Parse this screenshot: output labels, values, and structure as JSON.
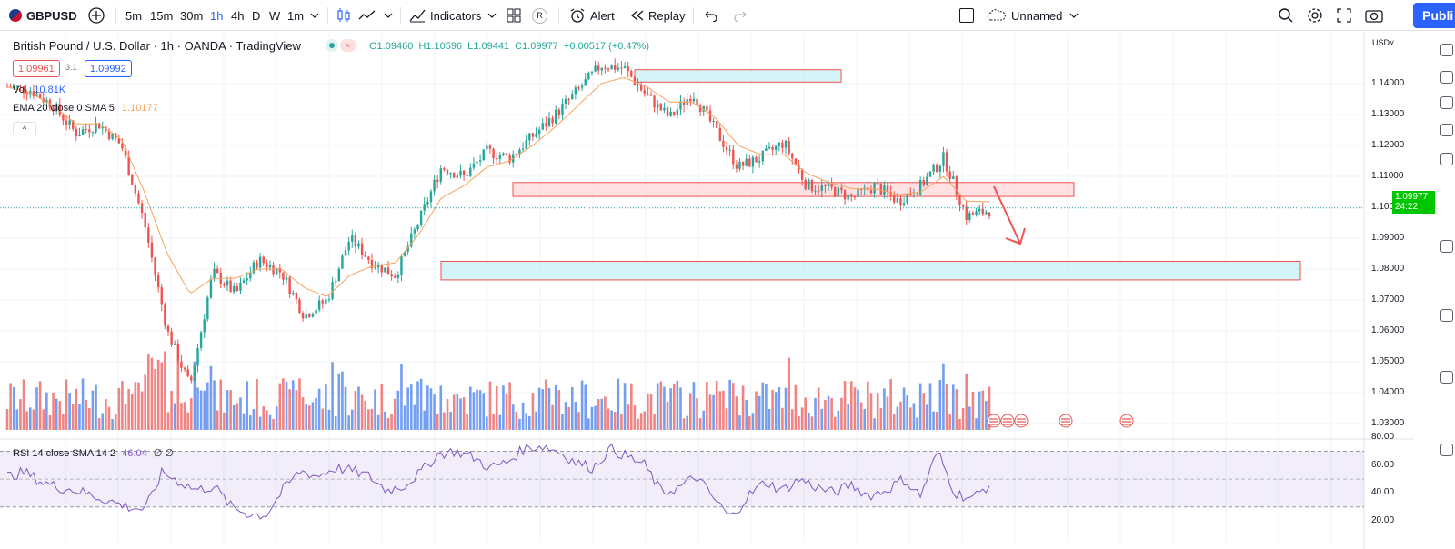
{
  "toolbar": {
    "symbol": "GBPUSD",
    "timeframes": [
      "5m",
      "15m",
      "30m",
      "1h",
      "4h",
      "D",
      "W",
      "1m"
    ],
    "active_timeframe": "1h",
    "indicators_label": "Indicators",
    "alert_label": "Alert",
    "replay_label": "Replay",
    "layout_name": "Unnamed",
    "publish_label": "Publi",
    "badge_r": "R"
  },
  "legend": {
    "title": "British Pound / U.S. Dollar · 1h · OANDA · TradingView",
    "open": "O1.09460",
    "high": "H1.10596",
    "low": "L1.09441",
    "close": "C1.09977",
    "change": "+0.00517 (+0.47%)",
    "sell_price": "1.09961",
    "spread": "3.1",
    "buy_price": "1.09992",
    "vol_label": "Vol",
    "vol_value": "10.81K",
    "ema_label": "EMA 20 close 0 SMA 5",
    "ema_value": "1.10177",
    "collapse": "^"
  },
  "rsi": {
    "label": "RSI 14 close SMA 14 2",
    "value": "46.04",
    "extra": "∅ ∅",
    "ticks": [
      "80.00",
      "60.00",
      "40.00",
      "20.00"
    ]
  },
  "price_axis": {
    "currency": "USD",
    "ticks": [
      "1.14000",
      "1.13000",
      "1.12000",
      "1.11000",
      "1.10000",
      "1.09000",
      "1.08000",
      "1.07000",
      "1.06000",
      "1.05000",
      "1.04000",
      "1.03000"
    ],
    "current_price": "1.09977",
    "countdown": "24:22"
  },
  "colors": {
    "up": "#26a69a",
    "down": "#ef5350",
    "ema": "#f7a35c",
    "rsi": "#7e57c2",
    "vol_up": "#5b8def",
    "vol_down": "#ef6f6c",
    "accent": "#2962ff",
    "current_price_bg": "#00c600"
  },
  "chart_data": {
    "type": "candlestick",
    "symbol": "GBPUSD",
    "interval": "1h",
    "ylim": [
      1.025,
      1.152
    ],
    "price_waypoints": [
      1.139,
      1.138,
      1.133,
      1.124,
      1.127,
      1.12,
      1.095,
      1.06,
      1.042,
      1.079,
      1.072,
      1.083,
      1.079,
      1.065,
      1.07,
      1.09,
      1.082,
      1.078,
      1.095,
      1.113,
      1.11,
      1.118,
      1.116,
      1.123,
      1.13,
      1.138,
      1.146,
      1.145,
      1.136,
      1.129,
      1.137,
      1.125,
      1.113,
      1.116,
      1.121,
      1.107,
      1.106,
      1.103,
      1.107,
      1.102,
      1.107,
      1.116,
      1.097,
      1.099
    ],
    "ema_waypoints": [
      1.139,
      1.137,
      1.133,
      1.127,
      1.127,
      1.122,
      1.105,
      1.085,
      1.072,
      1.077,
      1.077,
      1.08,
      1.08,
      1.074,
      1.071,
      1.078,
      1.081,
      1.082,
      1.091,
      1.103,
      1.107,
      1.113,
      1.115,
      1.12,
      1.126,
      1.133,
      1.14,
      1.142,
      1.139,
      1.134,
      1.134,
      1.129,
      1.12,
      1.117,
      1.117,
      1.111,
      1.108,
      1.106,
      1.106,
      1.104,
      1.105,
      1.11,
      1.102,
      1.1018
    ],
    "zones": [
      {
        "top": 1.1445,
        "bottom": 1.1405,
        "color": "cyan"
      },
      {
        "top": 1.108,
        "bottom": 1.1035,
        "color": "red"
      },
      {
        "top": 1.0825,
        "bottom": 1.0765,
        "color": "cyan"
      }
    ],
    "rsi_waypoints": [
      52,
      55,
      48,
      44,
      42,
      38,
      34,
      30,
      28,
      55,
      48,
      42,
      45,
      30,
      25,
      24,
      42,
      56,
      52,
      58,
      56,
      52,
      42,
      45,
      55,
      68,
      70,
      66,
      58,
      62,
      72,
      74,
      70,
      62,
      58,
      72,
      66,
      60,
      40,
      44,
      52,
      36,
      22,
      38,
      48,
      42,
      50,
      44,
      40,
      46,
      38,
      42,
      50,
      38,
      70,
      40,
      36,
      46
    ],
    "rsi_bands": [
      70,
      30
    ]
  }
}
